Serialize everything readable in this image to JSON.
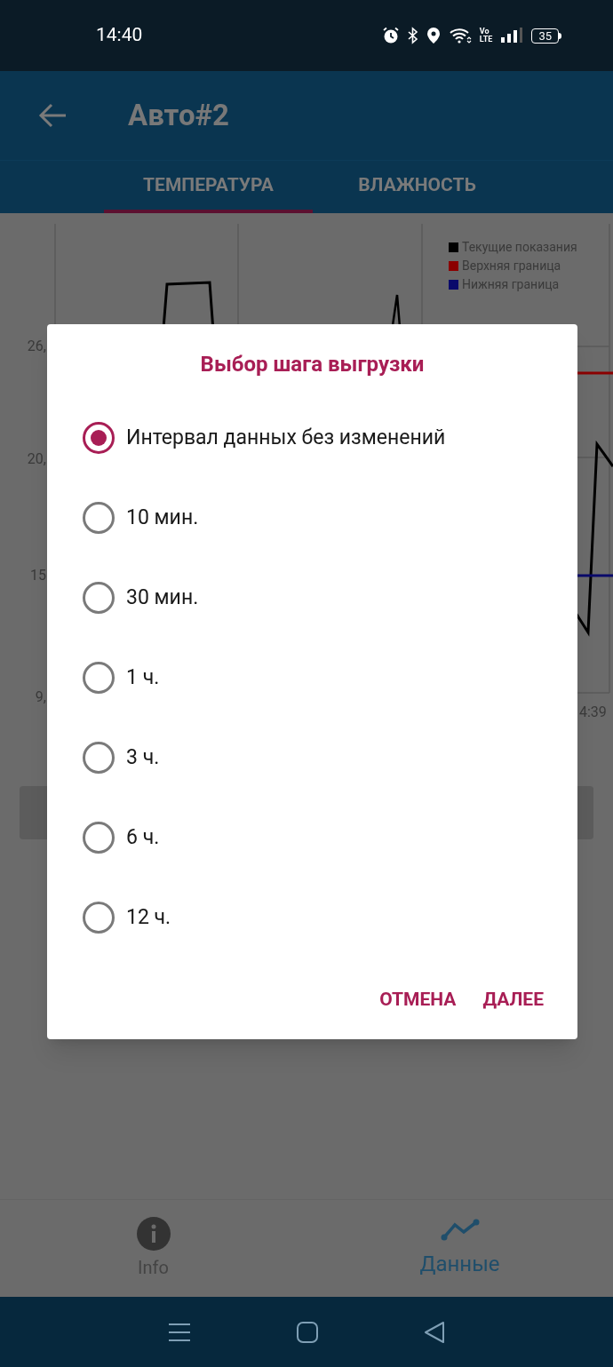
{
  "status_bar": {
    "time": "14:40",
    "volte": [
      "Vo",
      "LTE"
    ],
    "battery": "35"
  },
  "app_bar": {
    "title": "Авто#2"
  },
  "tabs": [
    {
      "label": "ТЕМПЕРАТУРА",
      "selected": true
    },
    {
      "label": "ВЛАЖНОСТЬ",
      "selected": false
    }
  ],
  "chart": {
    "legend": [
      {
        "label": "Текущие показания",
        "color": "#000000"
      },
      {
        "label": "Верхняя граница",
        "color": "#8b0000"
      },
      {
        "label": "Нижняя граница",
        "color": "#0a0a6b"
      }
    ],
    "y_labels": [
      "26,",
      "20,",
      "15",
      "9,"
    ],
    "x_label": "4:39"
  },
  "dialog": {
    "title": "Выбор шага выгрузки",
    "options": [
      {
        "label": "Интервал данных без изменений",
        "selected": true
      },
      {
        "label": "10 мин.",
        "selected": false
      },
      {
        "label": "30 мин.",
        "selected": false
      },
      {
        "label": "1 ч.",
        "selected": false
      },
      {
        "label": "3 ч.",
        "selected": false
      },
      {
        "label": "6 ч.",
        "selected": false
      },
      {
        "label": "12 ч.",
        "selected": false
      }
    ],
    "buttons": [
      "ОТМЕНА",
      "ДАЛЕЕ"
    ]
  },
  "bottom_nav": [
    {
      "label": "Info",
      "kind": "info",
      "selected": false
    },
    {
      "label": "Данные",
      "kind": "chart",
      "selected": true
    }
  ]
}
